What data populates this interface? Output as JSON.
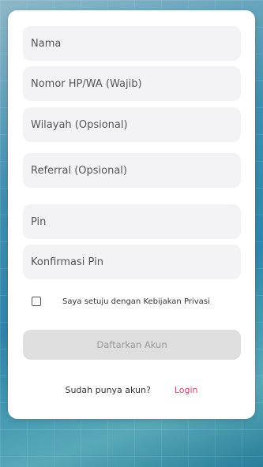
{
  "form": {
    "name_placeholder": "Nama",
    "phone_placeholder": "Nomor HP/WA (Wajib)",
    "region_placeholder": "Wilayah (Opsional)",
    "referral_placeholder": "Referral (Opsional)",
    "pin_placeholder": "Pin",
    "pin_confirm_placeholder": "Konfirmasi Pin",
    "privacy_label": "Saya setuju dengan Kebijakan Privasi",
    "submit_label": "Daftarkan Akun",
    "login_prompt": "Sudah punya akun?",
    "login_link": "Login"
  },
  "colors": {
    "accent": "#d4446c",
    "field_bg": "#f3f3f5",
    "button_disabled": "#dedede"
  }
}
